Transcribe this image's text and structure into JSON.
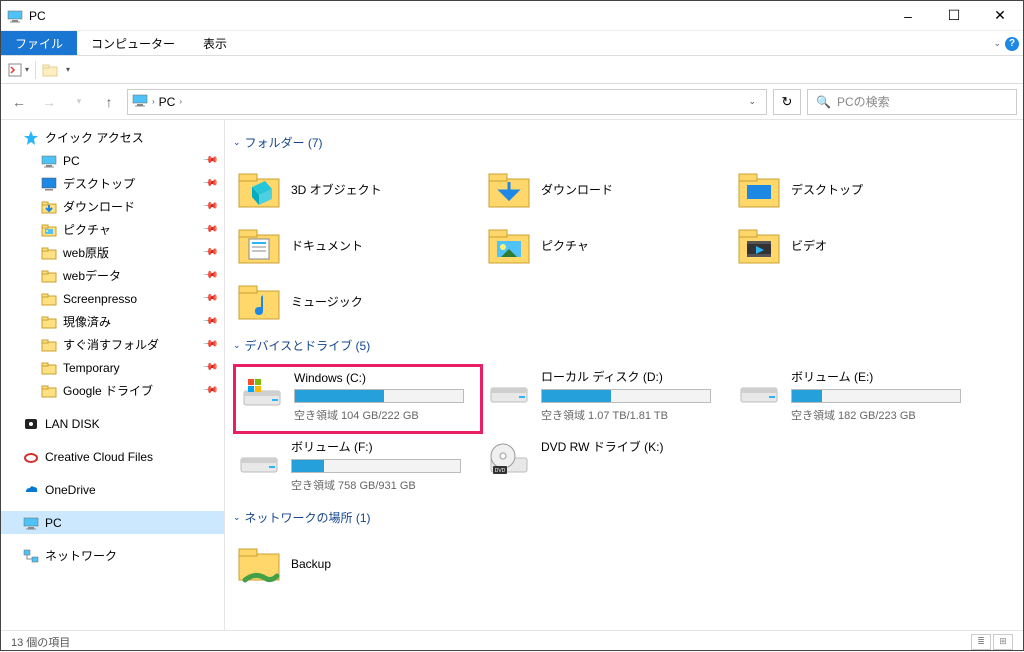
{
  "window": {
    "title": "PC",
    "minimize": "–",
    "maximize": "☐",
    "close": "✕"
  },
  "menubar": {
    "file": "ファイル",
    "computer": "コンピューター",
    "view": "表示"
  },
  "address": {
    "location": "PC",
    "search_placeholder": "PCの検索"
  },
  "sidebar": {
    "quick_access": "クイック アクセス",
    "items": [
      {
        "label": "PC",
        "icon": "pc"
      },
      {
        "label": "デスクトップ",
        "icon": "desktop"
      },
      {
        "label": "ダウンロード",
        "icon": "download"
      },
      {
        "label": "ピクチャ",
        "icon": "pictures"
      },
      {
        "label": "web原版",
        "icon": "folder"
      },
      {
        "label": "webデータ",
        "icon": "folder"
      },
      {
        "label": "Screenpresso",
        "icon": "folder"
      },
      {
        "label": "現像済み",
        "icon": "folder"
      },
      {
        "label": "すぐ消すフォルダ",
        "icon": "folder"
      },
      {
        "label": "Temporary",
        "icon": "folder"
      },
      {
        "label": "Google ドライブ",
        "icon": "folder"
      }
    ],
    "lan_disk": "LAN DISK",
    "creative_cloud": "Creative Cloud Files",
    "onedrive": "OneDrive",
    "pc": "PC",
    "network": "ネットワーク"
  },
  "groups": {
    "folders": {
      "title": "フォルダー (7)",
      "items": [
        {
          "label": "3D オブジェクト",
          "icon": "3d"
        },
        {
          "label": "ダウンロード",
          "icon": "download"
        },
        {
          "label": "デスクトップ",
          "icon": "desktop"
        },
        {
          "label": "ドキュメント",
          "icon": "documents"
        },
        {
          "label": "ピクチャ",
          "icon": "pictures"
        },
        {
          "label": "ビデオ",
          "icon": "videos"
        },
        {
          "label": "ミュージック",
          "icon": "music"
        }
      ]
    },
    "drives": {
      "title": "デバイスとドライブ (5)",
      "items": [
        {
          "label": "Windows (C:)",
          "free": "空き領域 104 GB/222 GB",
          "fill": 53,
          "highlight": true,
          "icon": "drive-win"
        },
        {
          "label": "ローカル ディスク (D:)",
          "free": "空き領域 1.07 TB/1.81 TB",
          "fill": 41,
          "icon": "drive"
        },
        {
          "label": "ボリューム (E:)",
          "free": "空き領域 182 GB/223 GB",
          "fill": 18,
          "icon": "drive"
        },
        {
          "label": "ボリューム (F:)",
          "free": "空き領域 758 GB/931 GB",
          "fill": 19,
          "icon": "drive"
        },
        {
          "label": "DVD RW ドライブ (K:)",
          "free": "",
          "fill": null,
          "icon": "dvd"
        }
      ]
    },
    "network": {
      "title": "ネットワークの場所 (1)",
      "items": [
        {
          "label": "Backup",
          "icon": "netfolder"
        }
      ]
    }
  },
  "statusbar": {
    "count": "13 個の項目"
  }
}
